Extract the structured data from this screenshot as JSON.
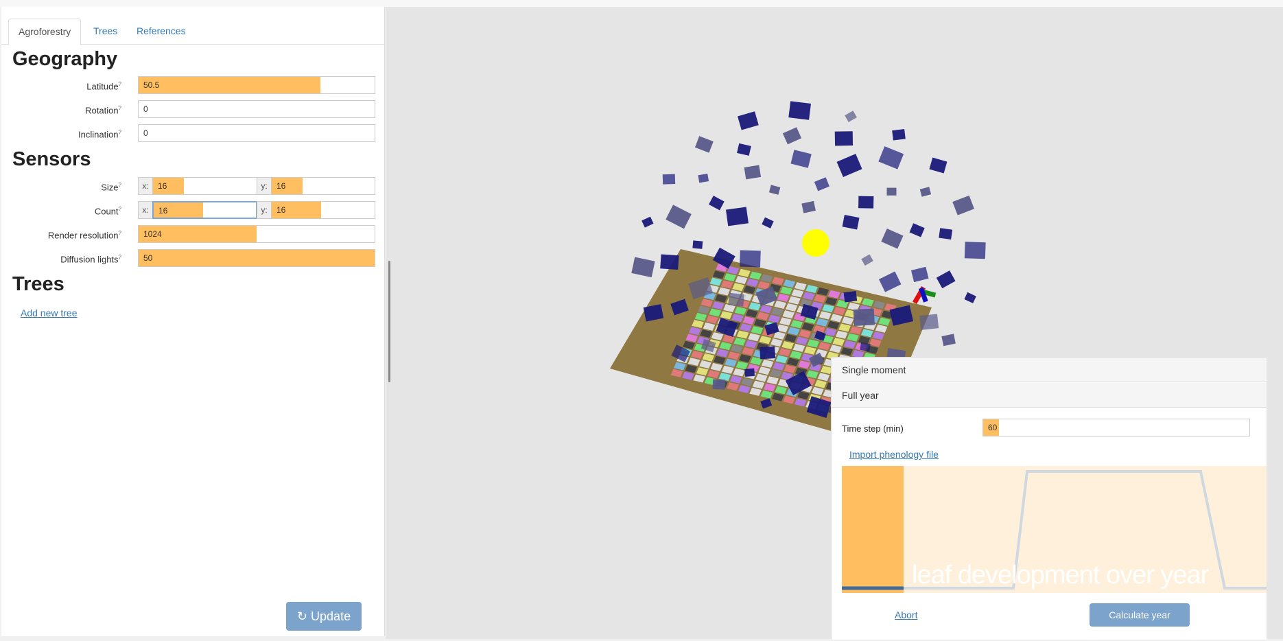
{
  "tabs": [
    "Agroforestry",
    "Trees",
    "References"
  ],
  "geography": {
    "title": "Geography",
    "latitude": {
      "label": "Latitude",
      "value": "50.5",
      "fraction": 0.77
    },
    "rotation": {
      "label": "Rotation",
      "value": "0"
    },
    "inclination": {
      "label": "Inclination",
      "value": "0"
    }
  },
  "sensors": {
    "title": "Sensors",
    "size": {
      "label": "Size",
      "x_prefix": "x:",
      "x": "16",
      "y_prefix": "y:",
      "y": "16"
    },
    "count": {
      "label": "Count",
      "x_prefix": "x:",
      "x": "16",
      "y_prefix": "y:",
      "y": "16"
    },
    "render_resolution": {
      "label": "Render resolution",
      "value": "1024",
      "fraction": 0.5
    },
    "diffusion_lights": {
      "label": "Diffusion lights",
      "value": "50",
      "fraction": 1.0
    }
  },
  "help_mark": "?",
  "trees": {
    "title": "Trees",
    "add_link": "Add new tree"
  },
  "update_button": {
    "label": "Update",
    "icon": "refresh-icon"
  },
  "simulation": {
    "single_moment": "Single moment",
    "full_year": "Full year",
    "time_step": {
      "label": "Time step (min)",
      "value": "60",
      "fraction": 0.06
    },
    "import_link": "Import phenology file",
    "phenology_caption": "leaf development over year",
    "abort_link": "Abort",
    "calculate_button": "Calculate year"
  },
  "colors": {
    "accent": "#ffbe60",
    "button": "#7ba3cc",
    "link": "#337ab7",
    "ground": "#8f7842",
    "sun": "#ffff00",
    "panel": "#1a1a7a"
  }
}
